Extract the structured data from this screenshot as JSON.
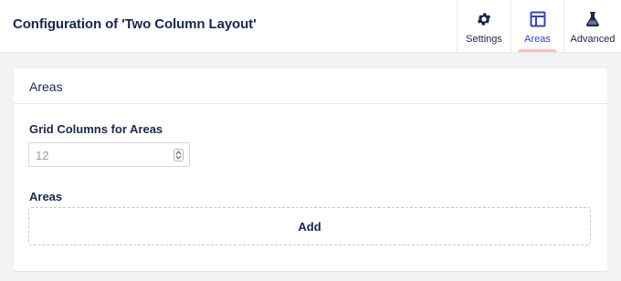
{
  "header": {
    "title": "Configuration of 'Two Column Layout'",
    "tabs": [
      {
        "label": "Settings",
        "icon": "gear-icon",
        "active": false
      },
      {
        "label": "Areas",
        "icon": "layout-icon",
        "active": true
      },
      {
        "label": "Advanced",
        "icon": "flask-icon",
        "active": false
      }
    ]
  },
  "panel": {
    "title": "Areas",
    "grid_columns": {
      "label": "Grid Columns for Areas",
      "value": "12"
    },
    "areas": {
      "label": "Areas",
      "add_label": "Add"
    }
  },
  "colors": {
    "text": "#1b264f",
    "active_tab_text": "#3544b1",
    "active_indicator": "#f5c1bc",
    "page_background": "#f3f3f5"
  }
}
